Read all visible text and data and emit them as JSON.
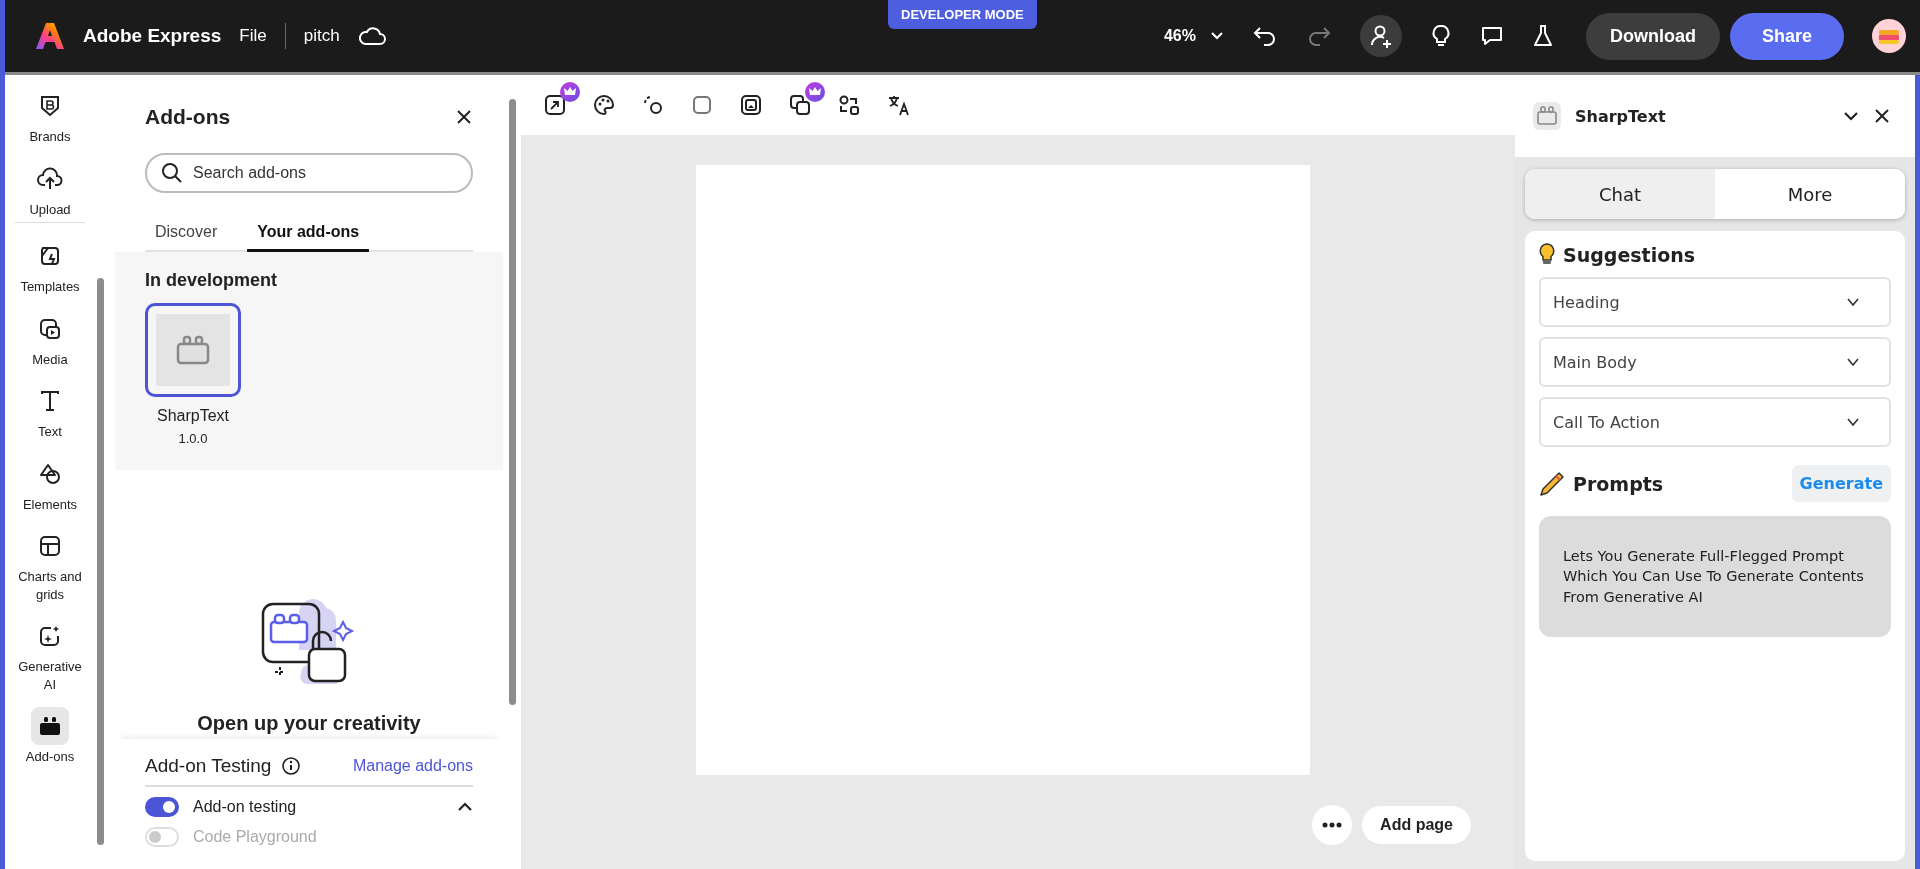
{
  "top_bar": {
    "app_name": "Adobe Express",
    "menu": "File",
    "document": "pitch",
    "developer_badge": "DEVELOPER MODE",
    "zoom": "46%",
    "download": "Download",
    "share": "Share"
  },
  "rail": [
    {
      "label": "Brands",
      "selected": false
    },
    {
      "label": "Upload",
      "selected": false
    },
    {
      "label": "Templates",
      "selected": false
    },
    {
      "label": "Media",
      "selected": false
    },
    {
      "label": "Text",
      "selected": false
    },
    {
      "label": "Elements",
      "selected": false
    },
    {
      "label": "Charts and grids",
      "selected": false
    },
    {
      "label": "Generative AI",
      "selected": false
    },
    {
      "label": "Add-ons",
      "selected": true
    }
  ],
  "addons_panel": {
    "title": "Add-ons",
    "search_placeholder": "Search add-ons",
    "tabs": [
      {
        "label": "Discover",
        "selected": false
      },
      {
        "label": "Your add-ons",
        "selected": true
      }
    ],
    "section": "In development",
    "items": [
      {
        "name": "SharpText",
        "version": "1.0.0",
        "selected": true
      }
    ],
    "promo": "Open up your creativity",
    "testing": {
      "title": "Add-on Testing",
      "link": "Manage add-ons",
      "expanded": true,
      "toggles": [
        {
          "label": "Add-on testing",
          "on": true,
          "disabled": false
        },
        {
          "label": "Code Playground",
          "on": false,
          "disabled": true
        }
      ]
    }
  },
  "canvas": {
    "add_page": "Add page"
  },
  "sharptext": {
    "title": "SharpText",
    "tabs": [
      {
        "label": "Chat",
        "selected": true
      },
      {
        "label": "More",
        "selected": false
      }
    ],
    "suggestions_title": "Suggestions",
    "suggestions": [
      {
        "label": "Heading",
        "expanded": false
      },
      {
        "label": "Main Body",
        "expanded": false
      },
      {
        "label": "Call To Action",
        "expanded": false
      }
    ],
    "prompts_title": "Prompts",
    "generate": "Generate",
    "description": "Lets You Generate Full-Flegged Prompt Which You Can Use To Generate Contents From Generative AI"
  }
}
